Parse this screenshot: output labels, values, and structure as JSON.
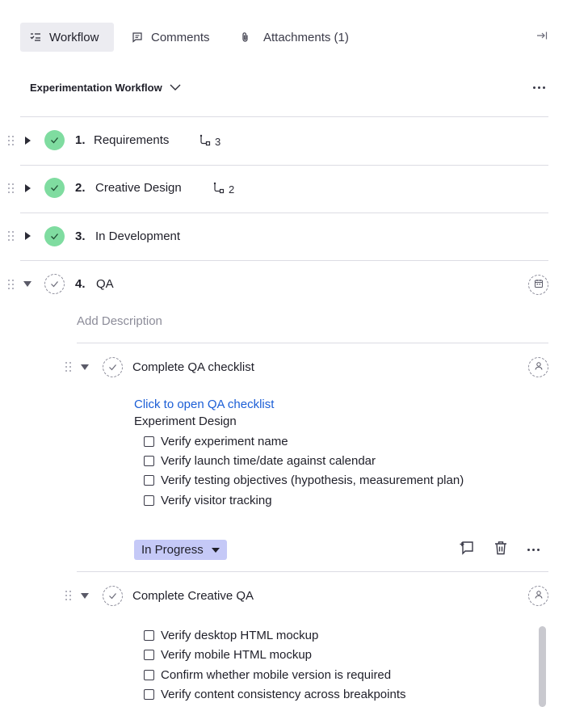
{
  "tabs": [
    {
      "label": "Workflow",
      "icon": "workflow-icon",
      "active": true
    },
    {
      "label": "Comments",
      "icon": "comment-icon",
      "active": false
    },
    {
      "label": "Attachments (1)",
      "icon": "paperclip-icon",
      "active": false
    }
  ],
  "workflow": {
    "title": "Experimentation Workflow",
    "steps": [
      {
        "num": "1.",
        "name": "Requirements",
        "status": "complete",
        "subtasks": "3"
      },
      {
        "num": "2.",
        "name": "Creative Design",
        "status": "complete",
        "subtasks": "2"
      },
      {
        "num": "3.",
        "name": "In Development",
        "status": "complete"
      },
      {
        "num": "4.",
        "name": "QA",
        "status": "open",
        "description_placeholder": "Add Description"
      }
    ]
  },
  "tasks": [
    {
      "name": "Complete QA checklist",
      "link": "Click to open QA checklist",
      "section": "Experiment Design",
      "checklist": [
        "Verify experiment name",
        "Verify launch time/date against calendar",
        "Verify testing objectives (hypothesis, measurement plan)",
        "Verify visitor tracking"
      ],
      "status": "In Progress"
    },
    {
      "name": "Complete Creative QA",
      "checklist": [
        "Verify desktop HTML mockup",
        "Verify mobile HTML mockup",
        "Confirm whether mobile version is required",
        "Verify content consistency across breakpoints"
      ]
    }
  ],
  "colors": {
    "complete": "#7fdca0",
    "status_pill": "#c5c9f7",
    "link": "#1b5ed6",
    "active_tab": "#ececf1"
  }
}
